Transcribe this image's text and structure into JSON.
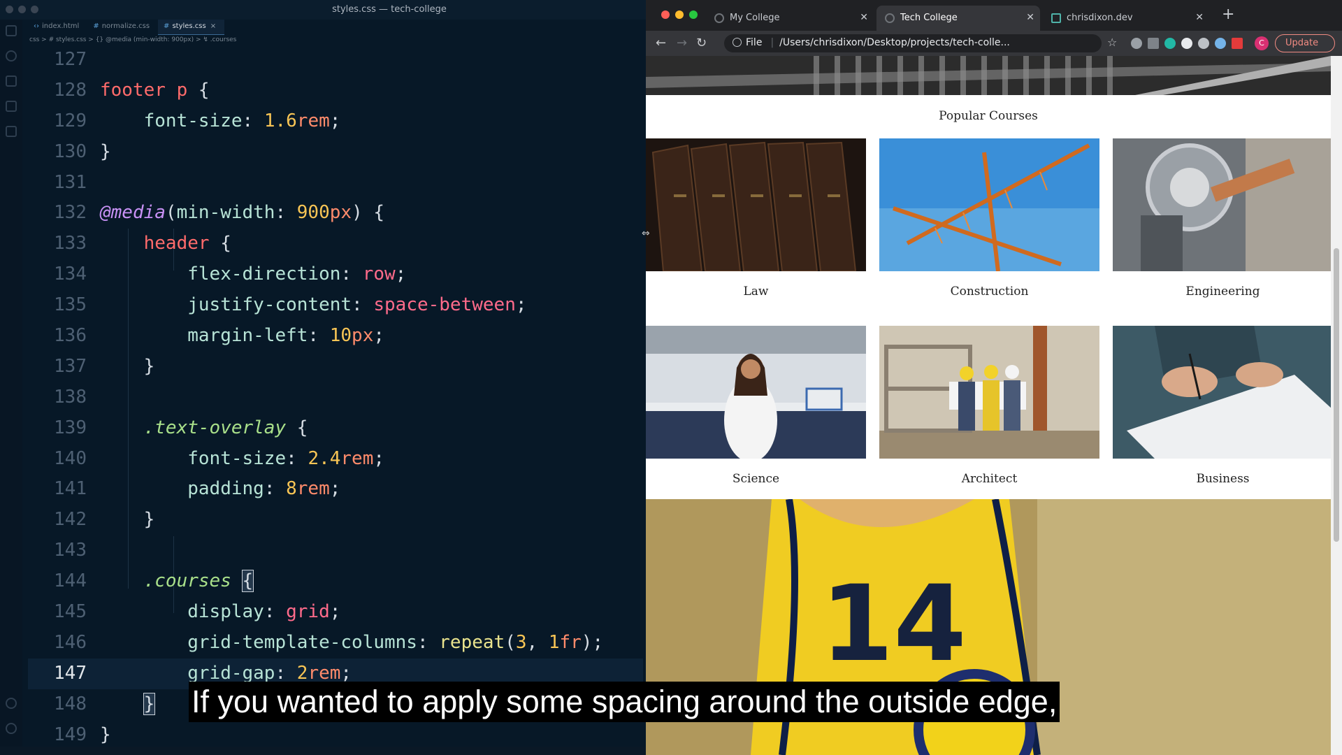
{
  "editor": {
    "window_title": "styles.css — tech-college",
    "tabs": [
      {
        "label": "index.html",
        "active": false
      },
      {
        "label": "normalize.css",
        "active": false
      },
      {
        "label": "styles.css",
        "active": true
      }
    ],
    "breadcrumb": "css > # styles.css > {} @media (min-width: 900px) > ↯ .courses",
    "current_line": 147,
    "lines": [
      {
        "n": 127,
        "html": ""
      },
      {
        "n": 128,
        "html": "<span class='t-sel'>footer p</span> <span class='t-punc'>{</span>"
      },
      {
        "n": 129,
        "html": "    <span class='t-prop'>font-size</span><span class='t-punc'>:</span> <span class='t-num'>1.6</span><span class='t-unit'>rem</span><span class='t-punc'>;</span>"
      },
      {
        "n": 130,
        "html": "<span class='t-punc'>}</span>"
      },
      {
        "n": 131,
        "html": ""
      },
      {
        "n": 132,
        "html": "<span class='t-at'>@media</span><span class='t-punc'>(</span><span class='t-prop'>min-width</span><span class='t-punc'>:</span> <span class='t-num'>900</span><span class='t-unit'>px</span><span class='t-punc'>) {</span>"
      },
      {
        "n": 133,
        "html": "    <span class='t-sel'>header</span> <span class='t-punc'>{</span>"
      },
      {
        "n": 134,
        "html": "        <span class='t-prop'>flex-direction</span><span class='t-punc'>:</span> <span class='t-val'>row</span><span class='t-punc'>;</span>"
      },
      {
        "n": 135,
        "html": "        <span class='t-prop'>justify-content</span><span class='t-punc'>:</span> <span class='t-val'>space-between</span><span class='t-punc'>;</span>"
      },
      {
        "n": 136,
        "html": "        <span class='t-prop'>margin-left</span><span class='t-punc'>:</span> <span class='t-num'>10</span><span class='t-unit'>px</span><span class='t-punc'>;</span>"
      },
      {
        "n": 137,
        "html": "    <span class='t-punc'>}</span>"
      },
      {
        "n": 138,
        "html": ""
      },
      {
        "n": 139,
        "html": "    <span class='t-cls'>.text-overlay</span> <span class='t-punc'>{</span>"
      },
      {
        "n": 140,
        "html": "        <span class='t-prop'>font-size</span><span class='t-punc'>:</span> <span class='t-num'>2.4</span><span class='t-unit'>rem</span><span class='t-punc'>;</span>"
      },
      {
        "n": 141,
        "html": "        <span class='t-prop'>padding</span><span class='t-punc'>:</span> <span class='t-num'>8</span><span class='t-unit'>rem</span><span class='t-punc'>;</span>"
      },
      {
        "n": 142,
        "html": "    <span class='t-punc'>}</span>"
      },
      {
        "n": 143,
        "html": ""
      },
      {
        "n": 144,
        "html": "    <span class='t-cls'>.courses</span> <span class='t-punc cursor-brace'>{</span>"
      },
      {
        "n": 145,
        "html": "        <span class='t-prop'>display</span><span class='t-punc'>:</span> <span class='t-val'>grid</span><span class='t-punc'>;</span>"
      },
      {
        "n": 146,
        "html": "        <span class='t-prop'>grid-template-columns</span><span class='t-punc'>:</span> <span class='t-fn'>repeat</span><span class='t-punc'>(</span><span class='t-num'>3</span><span class='t-punc'>,</span> <span class='t-num'>1</span><span class='t-unit'>fr</span><span class='t-punc'>);</span>"
      },
      {
        "n": 147,
        "html": "        <span class='t-prop'>grid-gap</span><span class='t-punc'>:</span> <span class='t-num'>2</span><span class='t-unit'>rem</span><span class='t-punc'>;</span>"
      },
      {
        "n": 148,
        "html": "    <span class='t-punc cursor-brace'>}</span>"
      },
      {
        "n": 149,
        "html": "<span class='t-punc'>}</span>"
      }
    ]
  },
  "browser": {
    "tabs": [
      {
        "label": "My College",
        "active": false
      },
      {
        "label": "Tech College",
        "active": true
      },
      {
        "label": "chrisdixon.dev",
        "active": false
      }
    ],
    "new_tab": "+",
    "omnibox": {
      "scheme_label": "File",
      "url": "/Users/chrisdixon/Desktop/projects/tech-colle..."
    },
    "profile_initial": "C",
    "update_label": "Update",
    "page": {
      "section_title": "Popular Courses",
      "courses": [
        {
          "label": "Law",
          "image": "law-books"
        },
        {
          "label": "Construction",
          "image": "crane"
        },
        {
          "label": "Engineering",
          "image": "lathe"
        },
        {
          "label": "Science",
          "image": "lab-scientist"
        },
        {
          "label": "Architect",
          "image": "site-workers"
        },
        {
          "label": "Business",
          "image": "signing-paper"
        }
      ],
      "banner_image": "volleyball-player",
      "jersey_number": "14"
    }
  },
  "caption": "If you wanted to apply some spacing around the outside edge,"
}
